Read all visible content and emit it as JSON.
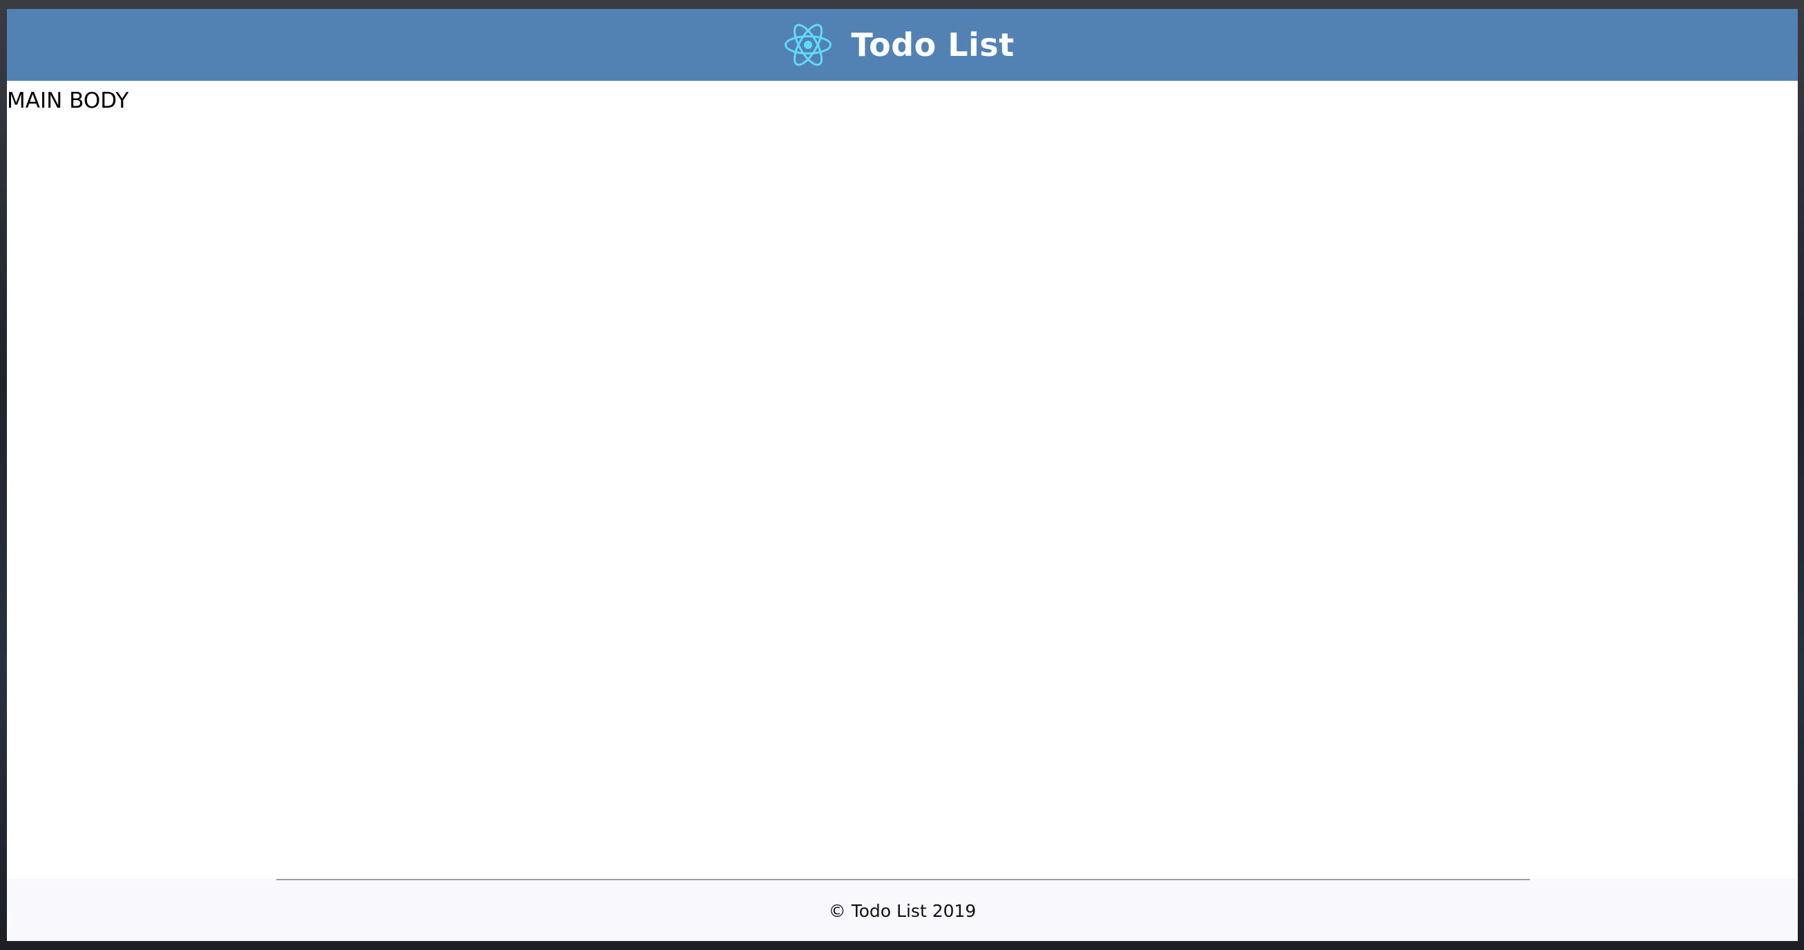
{
  "header": {
    "logo_icon": "react-atom-icon",
    "title": "Todo List",
    "background_color": "#5282b3",
    "logo_color": "#61dafb"
  },
  "main": {
    "body_text": "MAIN BODY"
  },
  "footer": {
    "copyright": "© Todo List 2019",
    "background_color": "#f8f8fd"
  }
}
